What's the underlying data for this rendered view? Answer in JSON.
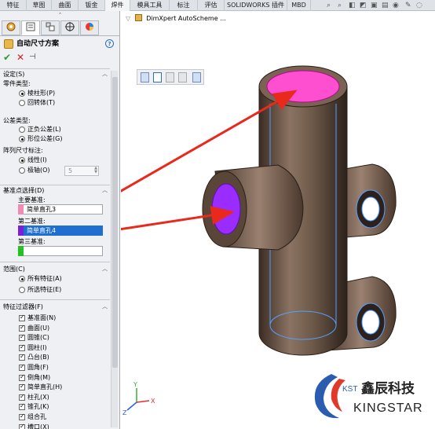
{
  "ribbon": {
    "tabs": [
      "特征",
      "草图",
      "曲面",
      "钣金",
      "焊件",
      "模具工具",
      "标注",
      "评估",
      "SOLIDWORKS 插件",
      "MBD"
    ]
  },
  "property_manager": {
    "grip": "⌃",
    "tab_icons": [
      "feature-manager",
      "property-manager",
      "configuration-manager",
      "dimxpert-manager",
      "display-manager"
    ],
    "title": "自动尺寸方案",
    "help": "?",
    "actions": {
      "ok": "✔",
      "cancel": "✕",
      "pin": "⊣"
    },
    "settings": {
      "header": "设定(S)",
      "part_type_label": "零件类型:",
      "part_types": [
        {
          "label": "棱柱形(P)",
          "selected": true
        },
        {
          "label": "回转体(T)",
          "selected": false
        }
      ],
      "tolerance_label": "公差类型:",
      "tolerances": [
        {
          "label": "正负公差(L)",
          "selected": false
        },
        {
          "label": "形位公差(G)",
          "selected": true
        }
      ],
      "pattern_label": "阵列尺寸标注:",
      "patterns": [
        {
          "label": "线性(I)",
          "selected": true
        },
        {
          "label": "极轴(O)",
          "selected": false
        }
      ],
      "polar_value": "5"
    },
    "datums": {
      "header": "基准点选择(D)",
      "primary_label": "主要基准:",
      "primary_value": "简单直孔3",
      "primary_color": "#f08cb4",
      "secondary_label": "第二基准:",
      "secondary_value": "简单直孔4",
      "secondary_color": "#7a1fd8",
      "tertiary_label": "第三基准:",
      "tertiary_value": "",
      "tertiary_color": "#22c222"
    },
    "scope": {
      "header": "范围(C)",
      "options": [
        {
          "label": "所有特征(A)",
          "selected": true
        },
        {
          "label": "所选特征(E)",
          "selected": false
        }
      ]
    },
    "feature_filters": {
      "header": "特征过滤器(F)",
      "items": [
        {
          "label": "基准面(N)",
          "checked": true
        },
        {
          "label": "曲面(U)",
          "checked": true
        },
        {
          "label": "圆锥(C)",
          "checked": true
        },
        {
          "label": "圆柱(I)",
          "checked": true
        },
        {
          "label": "凸台(B)",
          "checked": true
        },
        {
          "label": "圆角(F)",
          "checked": true
        },
        {
          "label": "倒角(M)",
          "checked": true
        },
        {
          "label": "简单直孔(H)",
          "checked": true
        },
        {
          "label": "柱孔(X)",
          "checked": true
        },
        {
          "label": "锥孔(K)",
          "checked": true
        },
        {
          "label": "组合孔",
          "checked": true
        },
        {
          "label": "槽口(X)",
          "checked": true
        }
      ]
    }
  },
  "graphics": {
    "tree_label": "DimXpert AutoScheme ...",
    "triad": {
      "x": "X",
      "y": "Y",
      "z": "Z"
    },
    "part_color": "#6e5a4a",
    "highlight_primary": "#ff4fd1",
    "highlight_secondary": "#9b2cff",
    "arrow_color": "#e8291c"
  },
  "brand": {
    "prefix": "KST",
    "name_cn": "鑫辰科技",
    "name_en": "KINGSTAR"
  }
}
